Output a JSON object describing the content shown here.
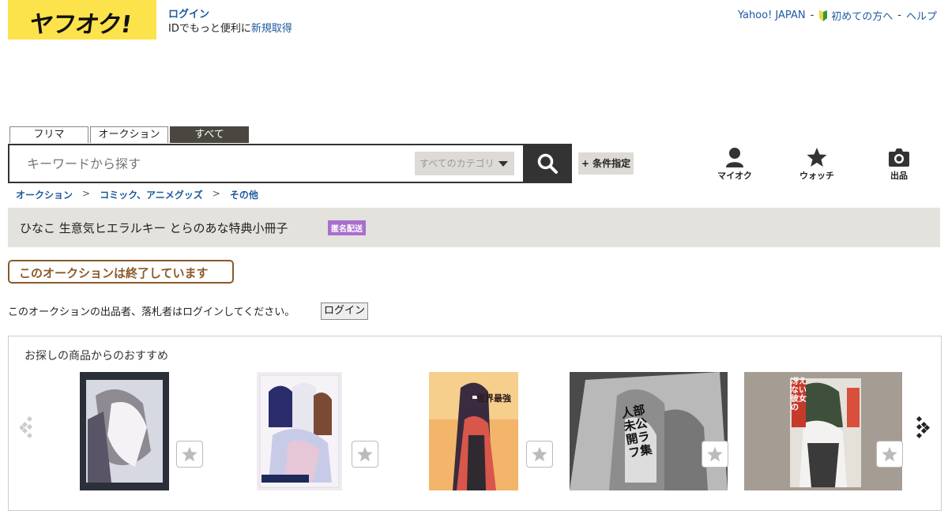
{
  "header": {
    "logo_text": "ヤフオク!",
    "login_label": "ログイン",
    "signup_prefix": "IDでもっと便利に",
    "signup_link": "新規取得",
    "top_links": [
      "Yahoo! JAPAN",
      "初めての方へ",
      "ヘルプ"
    ]
  },
  "search": {
    "tabs": [
      "フリマ",
      "オークション",
      "すべて"
    ],
    "active_tab": "すべて",
    "placeholder": "キーワードから探す",
    "category": "すべてのカテゴリ",
    "condition_label": "+ 条件指定"
  },
  "nav_icons": {
    "myauc": "マイオク",
    "watch": "ウォッチ",
    "sell": "出品"
  },
  "breadcrumb": [
    "オークション",
    "コミック、アニメグッズ",
    "その他"
  ],
  "breadcrumb_sep": ">",
  "item": {
    "title": "ひなこ 生意気ヒエラルキー とらのあな特典小冊子",
    "badge": "匿名配送"
  },
  "ended_notice": "このオークションは終了しています",
  "login_prompt": {
    "message": "このオークションの出品者、落札者はログインしてください。",
    "button": "ログイン"
  },
  "recommend": {
    "title": "お探しの商品からのおすすめ",
    "items": [
      {
        "cover_text": "",
        "colors": [
          "#2b2f3a",
          "#d7d9e2",
          "#8e8a92"
        ]
      },
      {
        "cover_text": "",
        "colors": [
          "#f0ecf2",
          "#c8cbe8",
          "#e6c7d8"
        ]
      },
      {
        "cover_text": "世界最強",
        "colors": [
          "#f2b56a",
          "#3a2b3e",
          "#d9564a"
        ]
      },
      {
        "cover_text": "人部未公開ラフ集",
        "colors": [
          "#8d8d8d",
          "#b9b9b9",
          "#4a4a4a"
        ]
      },
      {
        "cover_text": "冴えない彼女の",
        "colors": [
          "#a59d93",
          "#3e4f3b",
          "#e4e0da"
        ]
      }
    ]
  },
  "colors": {
    "logo_yellow": "#fde34b",
    "link_blue": "#1c5a9e",
    "ended_brown": "#8a5a2b",
    "badge_purple": "#a86fcf"
  }
}
